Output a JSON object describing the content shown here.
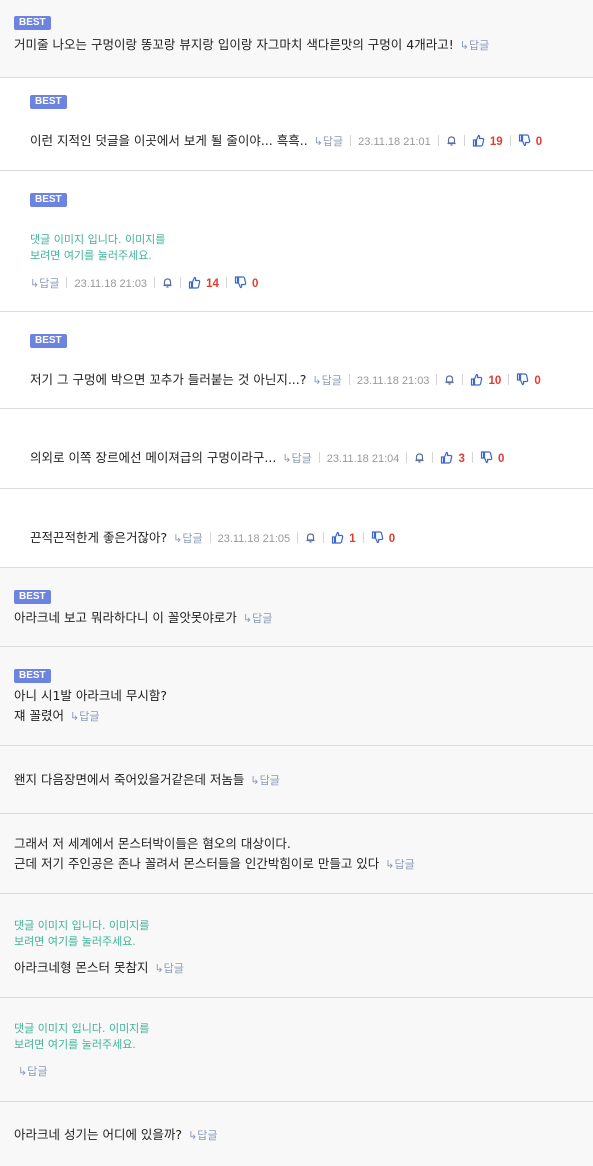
{
  "best_label": "BEST",
  "reply_label": "↳답글",
  "image_note_line1": "댓글 이미지 입니다. 이미지를",
  "image_note_line2": "보려면 여기를 눌러주세요.",
  "comments": [
    {
      "text": "거미줄 나오는 구멍이랑 똥꼬랑 뷰지랑 입이랑 자그마치 색다른맛의 구멍이 4개라고!"
    },
    {
      "text": "이런 지적인 덧글을  이곳에서 보게 될 줄이야... 흑흑..",
      "date": "23.11.18 21:01",
      "up": "19",
      "down": "0"
    },
    {
      "date": "23.11.18 21:03",
      "up": "14",
      "down": "0"
    },
    {
      "text": "저기 그 구멍에 박으면 꼬추가 들러붙는 것 아닌지...?",
      "date": "23.11.18 21:03",
      "up": "10",
      "down": "0"
    },
    {
      "text": "의외로 이쪽 장르에선 메이져급의 구멍이라구...",
      "date": "23.11.18 21:04",
      "up": "3",
      "down": "0"
    },
    {
      "text": "끈적끈적한게 좋은거잖아?",
      "date": "23.11.18 21:05",
      "up": "1",
      "down": "0"
    },
    {
      "text": "아라크네 보고 뭐라하다니 이 꼴앗못야로가"
    },
    {
      "line1": "아니 시1발 아라크네 무시함?",
      "line2": "쟤 꼴렸어"
    },
    {
      "text": "왠지 다음장면에서 죽어있을거같은데 저놈들"
    },
    {
      "line1": "그래서 저 세계에서 몬스터박이들은 혐오의 대상이다.",
      "line2": "근데 저기 주인공은 존나 꼴려서 몬스터들을 인간박힘이로 만들고 있다"
    },
    {
      "text": "아라크네형 몬스터 못참지"
    },
    {},
    {
      "text": "아라크네 성기는 어디에 있을까?"
    }
  ]
}
